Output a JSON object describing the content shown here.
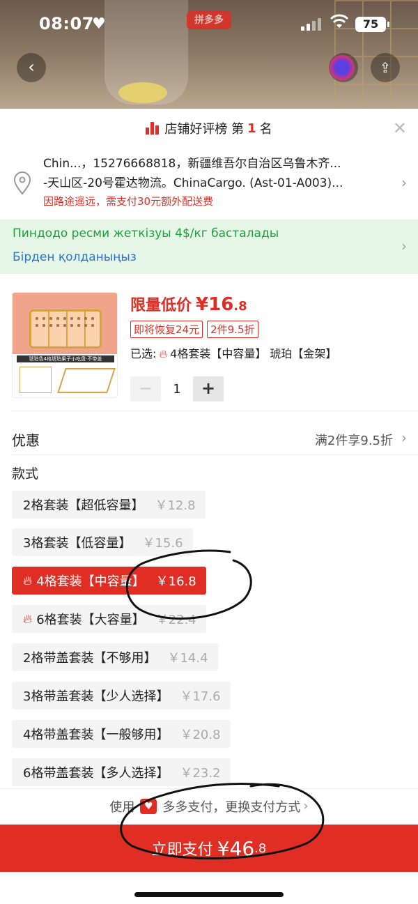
{
  "status_bar": {
    "time": "08:07",
    "battery": "75",
    "app_badge": "拼多多"
  },
  "header": {
    "rank_prefix": "店铺好评榜 第",
    "rank_number": "1",
    "rank_suffix": "名"
  },
  "address": {
    "line1": "Chin...，15276668818，新疆维吾尔自治区乌鲁木齐...",
    "line2": "-天山区-20号霍达物流。ChinaCargo. (Ast-01-A003)...",
    "warning": "因路途遥远，需支付30元额外配送费"
  },
  "promo": {
    "line1": "Пиндодо ресми жеткізуы 4$/кг басталады",
    "line2": "Бірден қолданыңыз"
  },
  "product": {
    "price_label": "限量低价",
    "price_int": "¥16",
    "price_dec": ".8",
    "tags": [
      "即将恢复24元",
      "2件9.5折"
    ],
    "selected_prefix": "已选:",
    "selected_value": "4格套装【中容量】 琥珀【金架】",
    "quantity": "1",
    "thumb_caption": "琥珀色4格琥珀果子小吃盘·不带盖"
  },
  "discount": {
    "title": "优惠",
    "value": "满2件享9.5折"
  },
  "style_section": {
    "title": "款式",
    "options": [
      {
        "label": "2格套装【超低容量】",
        "price": "￥12.8",
        "hot": false,
        "active": false
      },
      {
        "label": "3格套装【低容量】",
        "price": "￥15.6",
        "hot": false,
        "active": false
      },
      {
        "label": "4格套装【中容量】",
        "price": "￥16.8",
        "hot": true,
        "active": true
      },
      {
        "label": "6格套装【大容量】",
        "price": "￥22.4",
        "hot": true,
        "active": false
      },
      {
        "label": "2格带盖套装【不够用】",
        "price": "￥14.4",
        "hot": false,
        "active": false
      },
      {
        "label": "3格带盖套装【少人选择】",
        "price": "￥17.6",
        "hot": false,
        "active": false
      },
      {
        "label": "4格带盖套装【一般够用】",
        "price": "￥20.8",
        "hot": false,
        "active": false
      },
      {
        "label": "6格带盖套装【多人选择】",
        "price": "￥23.2",
        "hot": false,
        "active": false
      }
    ]
  },
  "payment": {
    "method_prefix": "使用",
    "method_text": "多多支付，更换支付方式",
    "button_label": "立即支付",
    "button_amount_int": "¥46",
    "button_amount_dec": ".8"
  },
  "colors": {
    "accent": "#e02e24",
    "promo_bg": "#e6f7e7",
    "promo_green": "#1aa13d",
    "promo_blue": "#2b73d4"
  }
}
